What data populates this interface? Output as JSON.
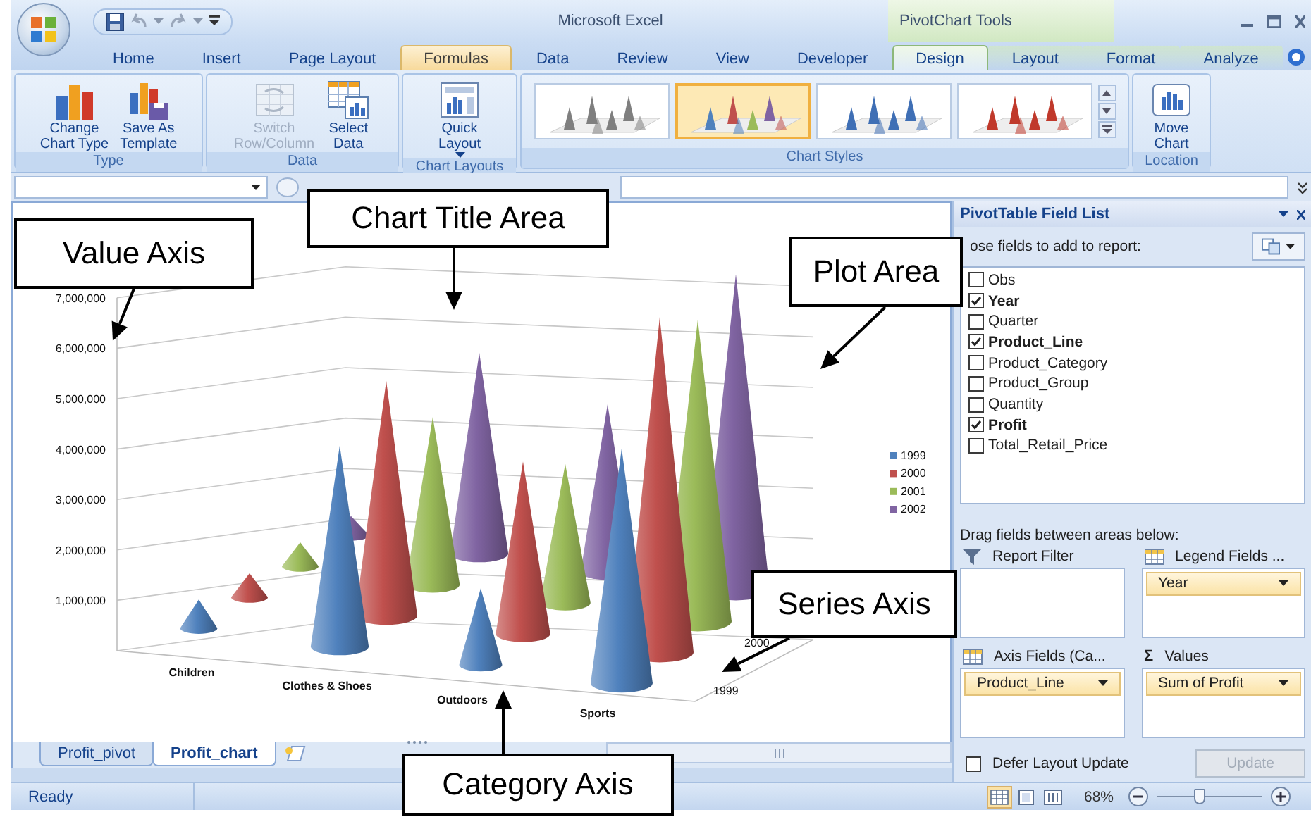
{
  "window": {
    "title": "Microsoft Excel",
    "context_title": "PivotChart Tools"
  },
  "tabs": [
    {
      "label": "Home",
      "selected": false,
      "hovered": false,
      "contextual": false
    },
    {
      "label": "Insert",
      "selected": false,
      "hovered": false,
      "contextual": false
    },
    {
      "label": "Page Layout",
      "selected": false,
      "hovered": false,
      "contextual": false
    },
    {
      "label": "Formulas",
      "selected": false,
      "hovered": true,
      "contextual": false
    },
    {
      "label": "Data",
      "selected": false,
      "hovered": false,
      "contextual": false
    },
    {
      "label": "Review",
      "selected": false,
      "hovered": false,
      "contextual": false
    },
    {
      "label": "View",
      "selected": false,
      "hovered": false,
      "contextual": false
    },
    {
      "label": "Developer",
      "selected": false,
      "hovered": false,
      "contextual": false
    },
    {
      "label": "Design",
      "selected": true,
      "hovered": false,
      "contextual": true
    },
    {
      "label": "Layout",
      "selected": false,
      "hovered": false,
      "contextual": true
    },
    {
      "label": "Format",
      "selected": false,
      "hovered": false,
      "contextual": true
    },
    {
      "label": "Analyze",
      "selected": false,
      "hovered": false,
      "contextual": true
    }
  ],
  "ribbon": {
    "groups": [
      {
        "title": "Type",
        "kind": "buttons",
        "buttons": [
          {
            "label": "Change\nChart Type",
            "kind": "change-type",
            "disabled": false,
            "dropdown": false
          },
          {
            "label": "Save As\nTemplate",
            "kind": "template",
            "disabled": false,
            "dropdown": false
          }
        ]
      },
      {
        "title": "Data",
        "kind": "buttons",
        "buttons": [
          {
            "label": "Switch\nRow/Column",
            "kind": "switch",
            "disabled": true,
            "dropdown": false
          },
          {
            "label": "Select\nData",
            "kind": "select-data",
            "disabled": false,
            "dropdown": false
          }
        ]
      },
      {
        "title": "Chart Layouts",
        "kind": "buttons",
        "buttons": [
          {
            "label": "Quick\nLayout",
            "kind": "quick-layout",
            "disabled": false,
            "dropdown": true
          }
        ]
      },
      {
        "title": "Chart Styles",
        "kind": "gallery",
        "styles": [
          {
            "kind": "mono",
            "color": "#7f7f7f",
            "selected": false
          },
          {
            "kind": "multi",
            "selected": true
          },
          {
            "kind": "mono",
            "color": "#3f6fb5",
            "selected": false
          },
          {
            "kind": "mono",
            "color": "#c0392b",
            "selected": false
          }
        ]
      },
      {
        "title": "Location",
        "kind": "buttons",
        "buttons": [
          {
            "label": "Move\nChart",
            "kind": "move",
            "disabled": false,
            "dropdown": false
          }
        ]
      }
    ]
  },
  "chart": {
    "value_axis": [
      "7,000,000",
      "6,000,000",
      "5,000,000",
      "4,000,000",
      "3,000,000",
      "2,000,000",
      "1,000,000"
    ],
    "categories": [
      "Children",
      "Clothes & Shoes",
      "Outdoors",
      "Sports"
    ],
    "series_axis": [
      "1999",
      "2000"
    ],
    "legend": [
      {
        "name": "1999",
        "color": "#4f81bd"
      },
      {
        "name": "2000",
        "color": "#c0504d"
      },
      {
        "name": "2001",
        "color": "#9bbb59"
      },
      {
        "name": "2002",
        "color": "#8064a2"
      }
    ]
  },
  "sheet_tabs": [
    {
      "label": "Profit_pivot",
      "selected": false
    },
    {
      "label": "Profit_chart",
      "selected": true
    }
  ],
  "pivot": {
    "title": "PivotTable Field List",
    "prompt": "ose fields to add to report:",
    "fields": [
      {
        "name": "Obs",
        "checked": false
      },
      {
        "name": "Year",
        "checked": true
      },
      {
        "name": "Quarter",
        "checked": false
      },
      {
        "name": "Product_Line",
        "checked": true
      },
      {
        "name": "Product_Category",
        "checked": false
      },
      {
        "name": "Product_Group",
        "checked": false
      },
      {
        "name": "Quantity",
        "checked": false
      },
      {
        "name": "Profit",
        "checked": true
      },
      {
        "name": "Total_Retail_Price",
        "checked": false
      }
    ],
    "areas_prompt": "Drag fields between areas below:",
    "areas": [
      {
        "label": "Report Filter",
        "kind": "filter"
      },
      {
        "label": "Legend Fields ...",
        "kind": "legend",
        "items": [
          "Year"
        ]
      },
      {
        "label": "Axis Fields (Ca...",
        "kind": "axis",
        "items": [
          "Product_Line"
        ]
      },
      {
        "label": "Values",
        "kind": "values",
        "symbol": "Σ",
        "items": [
          "Sum of Profit"
        ]
      }
    ],
    "defer": {
      "label": "Defer Layout Update",
      "checked": false
    },
    "update_button": {
      "label": "Update",
      "disabled": true
    }
  },
  "status_bar": {
    "status": "Ready",
    "views": [
      {
        "kind": "normal",
        "selected": true
      },
      {
        "kind": "page-layout",
        "selected": false
      },
      {
        "kind": "page-break",
        "selected": false
      }
    ],
    "zoom": "68%",
    "zoom_slider": {
      "level": 0.4
    }
  },
  "callouts": [
    {
      "text": "Value Axis",
      "kind": "value-axis"
    },
    {
      "text": "Chart Title Area",
      "kind": "chart-title"
    },
    {
      "text": "Plot Area",
      "kind": "plot-area"
    },
    {
      "text": "Series Axis",
      "kind": "series-axis"
    },
    {
      "text": "Category Axis",
      "kind": "category-axis"
    }
  ]
}
